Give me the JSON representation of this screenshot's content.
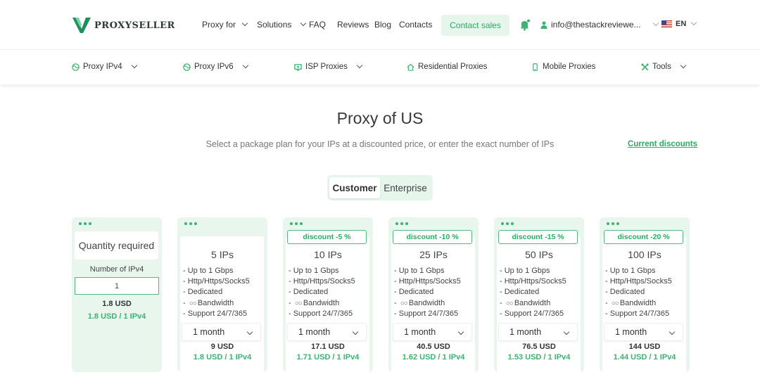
{
  "header": {
    "logo_text": "PROXYSELLER",
    "nav": [
      {
        "label": "Proxy for",
        "dropdown": true
      },
      {
        "label": "Solutions",
        "dropdown": true
      },
      {
        "label": "FAQ",
        "dropdown": false
      },
      {
        "label": "Reviews",
        "dropdown": false
      },
      {
        "label": "Blog",
        "dropdown": false
      },
      {
        "label": "Contacts",
        "dropdown": false
      }
    ],
    "contact_sales": "Contact sales",
    "user_email": "info@thestackreviewe...",
    "language": "EN"
  },
  "subnav": [
    {
      "label": "Proxy IPv4",
      "icon": "globe-icon"
    },
    {
      "label": "Proxy IPv6",
      "icon": "globe-icon"
    },
    {
      "label": "ISP Proxies",
      "icon": "isp-icon"
    },
    {
      "label": "Residential Proxies",
      "icon": "home-icon"
    },
    {
      "label": "Mobile Proxies",
      "icon": "phone-icon"
    },
    {
      "label": "Tools",
      "icon": "tools-icon"
    }
  ],
  "main": {
    "title": "Proxy of US",
    "subtitle": "Select a package plan for your IPs at a discounted price, or enter the exact number of IPs",
    "current_discounts": "Current discounts",
    "tabs": [
      {
        "label": "Customer",
        "active": true
      },
      {
        "label": "Enterprise",
        "active": false
      }
    ]
  },
  "quantity_card": {
    "title": "Quantity required",
    "label": "Number of IPv4",
    "value": "1",
    "total": "1.8 USD",
    "per_ip": "1.8 USD / 1 IPv4"
  },
  "features": [
    "- Up to 1 Gbps",
    "- Http/Https/Socks5",
    "- Dedicated",
    "- ",
    "Bandwidth",
    "- Support 24/7/365"
  ],
  "features_list": {
    "f1": "- Up to 1 Gbps",
    "f2": "- Http/Https/Socks5",
    "f3": "- Dedicated",
    "f4_prefix": "-",
    "f4_infinity": "○○",
    "f4": "Bandwidth",
    "f5": "- Support 24/7/365"
  },
  "plans": [
    {
      "discount": "",
      "ips": "5 IPs",
      "period": "1 month",
      "total": "9 USD",
      "per_ip": "1.8 USD / 1 IPv4"
    },
    {
      "discount": "discount -5 %",
      "ips": "10 IPs",
      "period": "1 month",
      "total": "17.1 USD",
      "per_ip": "1.71 USD / 1 IPv4"
    },
    {
      "discount": "discount -10 %",
      "ips": "25 IPs",
      "period": "1 month",
      "total": "40.5 USD",
      "per_ip": "1.62 USD / 1 IPv4"
    },
    {
      "discount": "discount -15 %",
      "ips": "50 IPs",
      "period": "1 month",
      "total": "76.5 USD",
      "per_ip": "1.53 USD / 1 IPv4"
    },
    {
      "discount": "discount -20 %",
      "ips": "100 IPs",
      "period": "1 month",
      "total": "144 USD",
      "per_ip": "1.44 USD / 1 IPv4"
    }
  ],
  "colors": {
    "accent": "#27ae60",
    "card_bg": "#e8f6ed",
    "button_bg": "#e6f6ec"
  }
}
